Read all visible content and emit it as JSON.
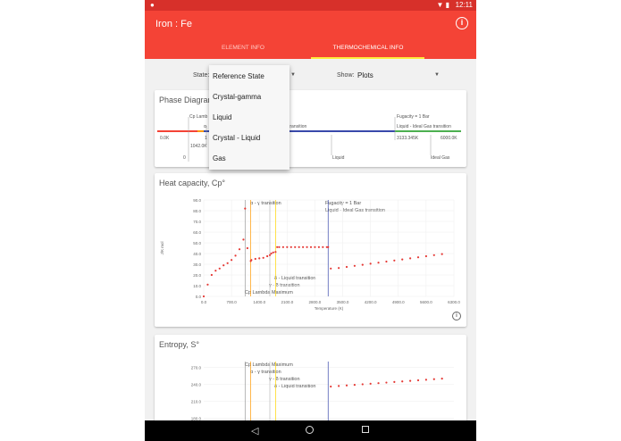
{
  "status_bar": {
    "time": "12:11",
    "notification_icon": "location-pin-icon",
    "system_icons": "wifi-battery-icons"
  },
  "app": {
    "title": "Iron : Fe",
    "info_icon": "info-icon"
  },
  "tabs": [
    {
      "label": "ELEMENT INFO",
      "active": false
    },
    {
      "label": "THERMOCHEMICAL INFO",
      "active": true
    }
  ],
  "controls": {
    "state_label": "State:",
    "show_label": "Show:",
    "show_value": "Plots",
    "state_options": [
      "Reference State",
      "Crystal-gamma",
      "Liquid",
      "Crystal - Liquid",
      "Gas"
    ]
  },
  "phase_card": {
    "title": "Phase Diagram",
    "labels": {
      "cp_lambda": "Cp Lamb",
      "fugacity": "Fugacity = 1 Bar",
      "liquid_gas": "Liquid - Ideal Gas transition",
      "transition": "transition",
      "t_zero": "0.0K",
      "t_1042": "1042.0K",
      "t_3133": "3133.345K",
      "t_6000": "6000.0K",
      "zero": "0",
      "one": "1",
      "liquid": "Liquid",
      "ideal_gas": "Ideal Gas",
      "alpha_cut": "α"
    },
    "colors": {
      "red": "#f44336",
      "orange": "#ff9800",
      "yellow": "#ffd600",
      "blue": "#3949ab",
      "green": "#4caf50"
    }
  },
  "cp_card": {
    "title": "Heat capacity, Cp°",
    "info_icon": "info-icon",
    "annotations": {
      "alpha_gamma": "α - γ transition",
      "fugacity": "Fugacity = 1 Bar",
      "liquid_gas": "Liquid - Ideal Gas transition",
      "delta_liquid": "δ - Liquid transition",
      "gamma_delta": "γ - δ transition",
      "cp_lambda": "Cp Lambda Maximum"
    }
  },
  "entropy_card": {
    "title": "Entropy, S°",
    "annotations": {
      "cp_lambda": "Cp Lambda Maximum",
      "alpha_gamma": "α - γ transition",
      "gamma_delta": "γ - δ transition",
      "delta_liquid": "δ - Liquid transition"
    }
  },
  "chart_data": [
    {
      "type": "scatter",
      "title": "Heat capacity, Cp°",
      "xlabel": "Temperature (K)",
      "ylabel": "J/K mol",
      "xlim": [
        0,
        6000
      ],
      "ylim": [
        0,
        90
      ],
      "x_ticks": [
        "0.0",
        "700.0",
        "1400.0",
        "2100.0",
        "2800.0",
        "3500.0",
        "4200.0",
        "4900.0",
        "5600.0",
        "6300.0"
      ],
      "y_ticks": [
        "0.0",
        "10.0",
        "20.0",
        "30.0",
        "40.0",
        "50.0",
        "60.0",
        "70.0",
        "80.0",
        "90.0"
      ],
      "vlines": [
        1042,
        1184,
        1665,
        1809,
        3133
      ],
      "series": [
        {
          "color": "#e53935",
          "x": [
            0,
            100,
            200,
            300,
            400,
            500,
            600,
            700,
            800,
            900,
            1000,
            1042,
            1100,
            1184,
            1200,
            1300,
            1400,
            1500,
            1600,
            1665,
            1700,
            1750,
            1809,
            1850,
            1900,
            2000,
            2100,
            2200,
            2300,
            2400,
            2500,
            2600,
            2700,
            2800,
            2900,
            3000,
            3100,
            3133,
            3200,
            3400,
            3600,
            3800,
            4000,
            4200,
            4400,
            4600,
            4800,
            5000,
            5200,
            5400,
            5600,
            5800,
            6000
          ],
          "y": [
            0,
            11,
            20,
            24,
            26,
            29,
            31,
            34,
            38,
            44,
            53,
            82,
            45,
            33,
            34,
            35,
            35.5,
            36,
            37.5,
            38.5,
            40,
            41,
            41.5,
            46,
            46,
            46,
            46,
            46,
            46,
            46,
            46,
            46,
            46,
            46,
            46,
            46,
            46,
            46,
            26,
            26.5,
            27.5,
            28.5,
            29.5,
            30.5,
            31.5,
            32.5,
            33.5,
            34.5,
            35.5,
            36.5,
            37.5,
            38.5,
            39.5
          ]
        }
      ]
    },
    {
      "type": "scatter",
      "title": "Entropy, S°",
      "y_ticks": [
        "180.0",
        "210.0",
        "240.0",
        "270.0"
      ],
      "ylim": [
        170,
        280
      ],
      "xlim": [
        0,
        6000
      ],
      "vlines": [
        1042,
        1184,
        1665,
        1809,
        3133
      ],
      "series": [
        {
          "color": "#e53935",
          "x": [
            3200,
            3400,
            3600,
            3800,
            4000,
            4200,
            4400,
            4600,
            4800,
            5000,
            5200,
            5400,
            5600,
            5800,
            6000
          ],
          "y": [
            236,
            237,
            238,
            239,
            240,
            241,
            242,
            243,
            244,
            245,
            246,
            247,
            248,
            249,
            250
          ]
        }
      ]
    }
  ]
}
